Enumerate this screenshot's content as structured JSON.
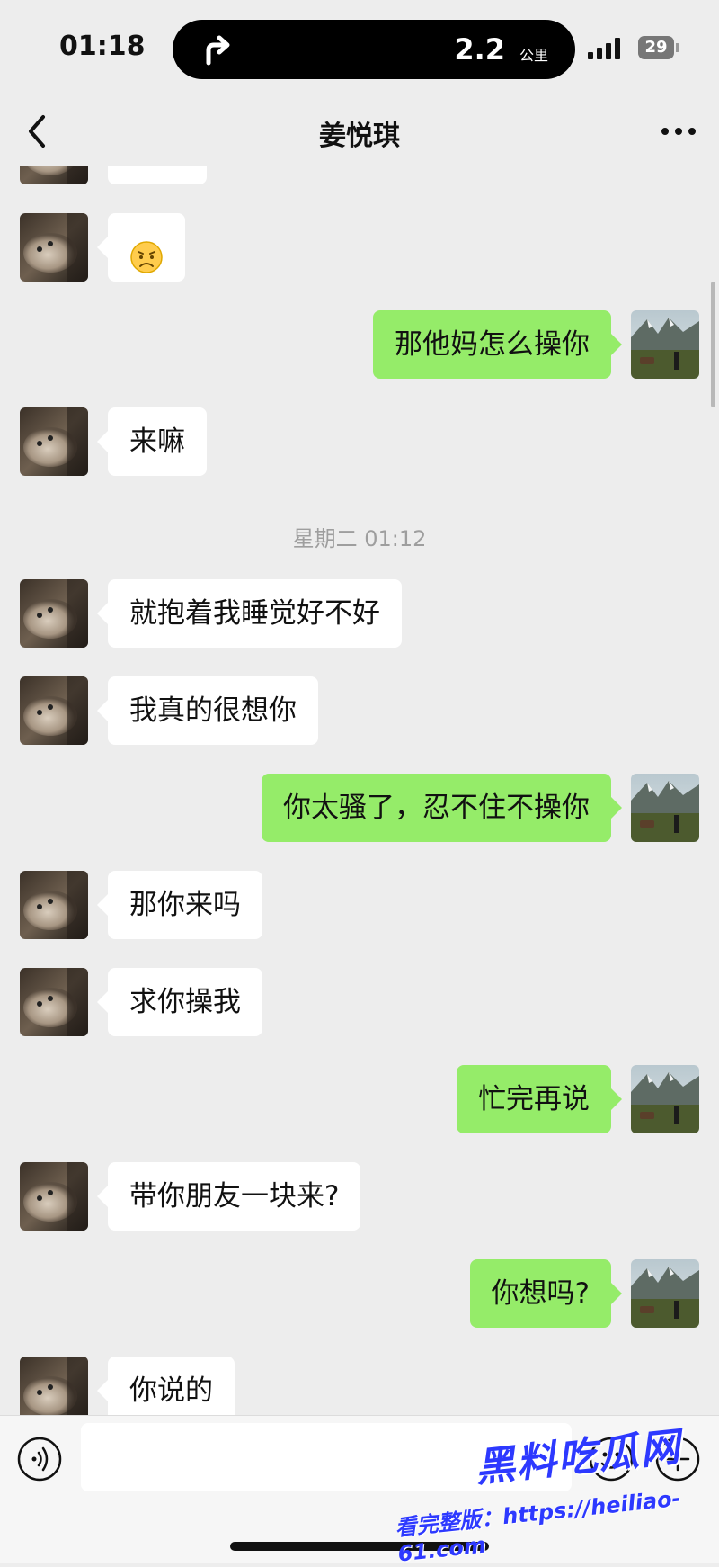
{
  "status_bar": {
    "time": "01:18",
    "distance_value": "2.2",
    "distance_unit": "公里",
    "battery": "29",
    "icons": [
      "navigation-arrow-icon",
      "signal-icon",
      "battery-icon"
    ]
  },
  "header": {
    "title": "姜悦琪",
    "back_icon": "chevron-left-icon",
    "more_icon": "more-dots-icon"
  },
  "conversation": {
    "timestamp": "星期二 01:12",
    "messages": [
      {
        "side": "left",
        "text": ""
      },
      {
        "side": "left",
        "text": "",
        "emoji": "sad-face-emoji"
      },
      {
        "side": "right",
        "text": "那他妈怎么操你"
      },
      {
        "side": "left",
        "text": "来嘛"
      },
      {
        "side": "left",
        "text": "就抱着我睡觉好不好"
      },
      {
        "side": "left",
        "text": "我真的很想你"
      },
      {
        "side": "right",
        "text": "你太骚了，忍不住不操你"
      },
      {
        "side": "left",
        "text": "那你来吗"
      },
      {
        "side": "left",
        "text": "求你操我"
      },
      {
        "side": "right",
        "text": "忙完再说"
      },
      {
        "side": "left",
        "text": "带你朋友一块来?"
      },
      {
        "side": "right",
        "text": "你想吗?"
      },
      {
        "side": "left",
        "text": "你说的"
      }
    ]
  },
  "input_bar": {
    "placeholder": "",
    "icons": [
      "voice-icon",
      "emoji-icon",
      "plus-icon"
    ]
  },
  "watermark": {
    "logo": "黑料吃瓜网",
    "url": "看完整版：https://heiliao-61.com"
  },
  "colors": {
    "background": "#ededed",
    "sent_bubble": "#95ec69",
    "received_bubble": "#ffffff",
    "timestamp_text": "#9e9e9e",
    "watermark": "#2d39ff"
  }
}
